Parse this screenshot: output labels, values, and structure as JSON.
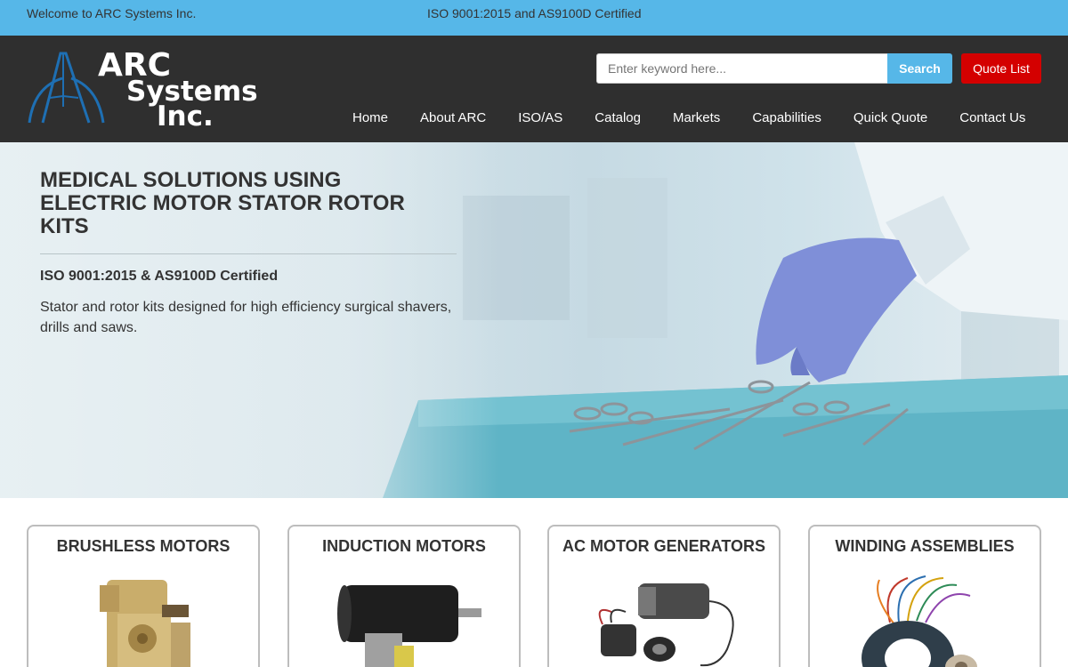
{
  "topbar": {
    "welcome": "Welcome to ARC Systems Inc.",
    "certification": "ISO 9001:2015 and AS9100D Certified"
  },
  "logo": {
    "line1": "ARC",
    "line2": "Systems",
    "line3": "Inc.",
    "color": "#1e6fb3"
  },
  "search": {
    "placeholder": "Enter keyword here...",
    "button_label": "Search"
  },
  "quote_list_label": "Quote List",
  "nav": {
    "items": [
      {
        "label": "Home"
      },
      {
        "label": "About ARC"
      },
      {
        "label": "ISO/AS"
      },
      {
        "label": "Catalog"
      },
      {
        "label": "Markets"
      },
      {
        "label": "Capabilities"
      },
      {
        "label": "Quick Quote"
      },
      {
        "label": "Contact Us"
      }
    ]
  },
  "hero": {
    "title": "MEDICAL SOLUTIONS USING ELECTRIC MOTOR STATOR ROTOR KITS",
    "subtitle": "ISO 9001:2015 & AS9100D Certified",
    "description": "Stator and rotor kits designed for high efficiency surgical shavers, drills and saws."
  },
  "products": [
    {
      "title": "BRUSHLESS MOTORS",
      "icon": "brushless-motor-image"
    },
    {
      "title": "INDUCTION MOTORS",
      "icon": "induction-motor-image"
    },
    {
      "title": "AC MOTOR GENERATORS",
      "icon": "ac-motor-generator-image"
    },
    {
      "title": "WINDING ASSEMBLIES",
      "icon": "winding-assembly-image"
    }
  ],
  "colors": {
    "topbar": "#56b7e8",
    "header": "#2f2f2f",
    "search_button": "#56b7e8",
    "quote_button": "#d40000"
  }
}
